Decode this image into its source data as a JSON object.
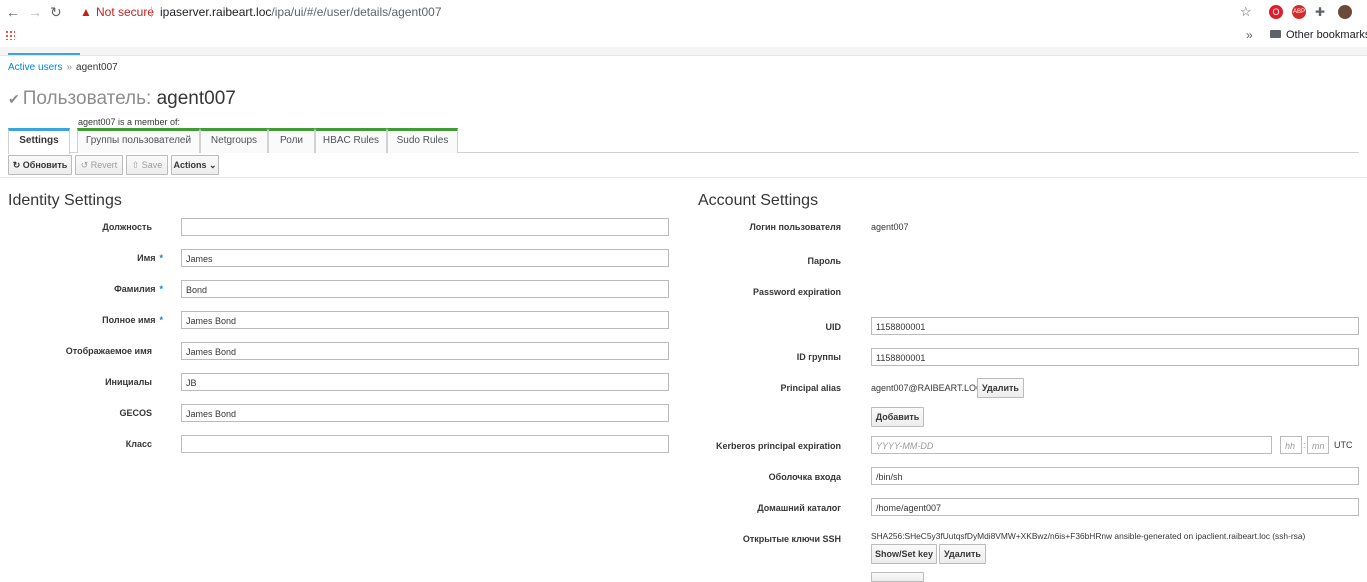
{
  "browser": {
    "not_secure": "Not secure",
    "url_host": "ipaserver.raibeart.loc",
    "url_path": "/ipa/ui/#/e/user/details/agent007",
    "bookmarks_other": "Other bookmarks"
  },
  "breadcrumb": {
    "parent": "Active users",
    "separator": "»",
    "current": "agent007"
  },
  "header": {
    "prefix": "Пользователь:",
    "name": "agent007"
  },
  "member_note": "agent007 is a member of:",
  "tabs": [
    "Settings",
    "Группы пользователей",
    "Netgroups",
    "Роли",
    "HBAC Rules",
    "Sudo Rules"
  ],
  "toolbar": {
    "refresh": "Обновить",
    "revert": "Revert",
    "save": "Save",
    "actions": "Actions"
  },
  "identity": {
    "title": "Identity Settings",
    "fields": [
      {
        "label": "Должность",
        "value": "",
        "required": false
      },
      {
        "label": "Имя",
        "value": "James",
        "required": true
      },
      {
        "label": "Фамилия",
        "value": "Bond",
        "required": true
      },
      {
        "label": "Полное имя",
        "value": "James Bond",
        "required": true
      },
      {
        "label": "Отображаемое имя",
        "value": "James Bond",
        "required": false
      },
      {
        "label": "Инициалы",
        "value": "JB",
        "required": false
      },
      {
        "label": "GECOS",
        "value": "James Bond",
        "required": false
      },
      {
        "label": "Класс",
        "value": "",
        "required": false
      }
    ]
  },
  "account": {
    "title": "Account Settings",
    "login_label": "Логин пользователя",
    "login_value": "agent007",
    "password_label": "Пароль",
    "pw_exp_label": "Password expiration",
    "uid_label": "UID",
    "uid_value": "1158800001",
    "gid_label": "ID группы",
    "gid_value": "1158800001",
    "principal_label": "Principal alias",
    "principal_value": "agent007@RAIBEART.LOC",
    "delete": "Удалить",
    "add": "Добавить",
    "krb_exp_label": "Kerberos principal expiration",
    "date_placeholder": "YYYY-MM-DD",
    "hh_placeholder": "hh",
    "mm_placeholder": "mn",
    "tz": "UTC",
    "colon": ":",
    "shell_label": "Оболочка входа",
    "shell_value": "/bin/sh",
    "home_label": "Домашний каталог",
    "home_value": "/home/agent007",
    "ssh_label": "Открытые ключи SSH",
    "ssh_value": "SHA256:SHeC5y3fUutqsfDyMdi8VMW+XKBwz/n6is+F36bHRnw ansible-generated on ipaclient.raibeart.loc (ssh-rsa)",
    "show_set_key": "Show/Set key"
  }
}
